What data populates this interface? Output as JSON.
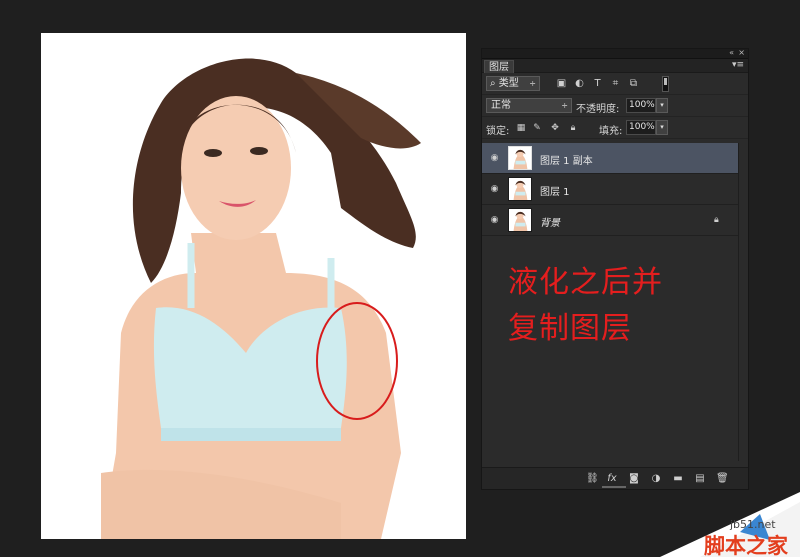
{
  "panel": {
    "collapse_glyph": "«",
    "close_glyph": "×",
    "tab_label": "图层",
    "menu_glyph": "▾≡",
    "filter": {
      "search_glyph": "⌕",
      "kind_label": "类型"
    },
    "blend_mode": "正常",
    "opacity_label": "不透明度:",
    "opacity_value": "100%",
    "lock_label": "锁定:",
    "fill_label": "填充:",
    "fill_value": "100%",
    "layers": [
      {
        "name": "图层 1 副本",
        "selected": true
      },
      {
        "name": "图层 1",
        "selected": false
      },
      {
        "name": "背景",
        "selected": false,
        "locked": true
      }
    ]
  },
  "annotation": {
    "line1": "液化之后并",
    "line2": "复制图层",
    "color": "#e41e1e"
  },
  "watermark": {
    "domain": "jb51.net",
    "name": "脚本之家"
  },
  "colors": {
    "app_bg": "#1f1f1f",
    "panel_bg": "#2b2b2b",
    "selected_layer": "#4c5463"
  }
}
